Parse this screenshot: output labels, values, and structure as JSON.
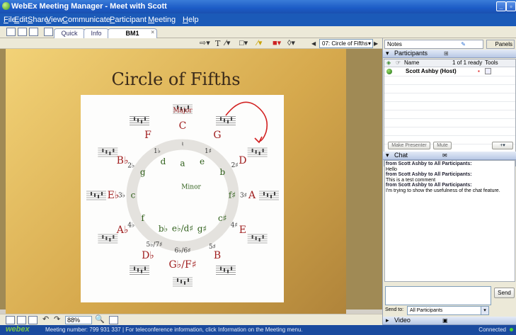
{
  "window": {
    "title": "WebEx Meeting Manager - Meet with Scott"
  },
  "menu": [
    "File",
    "Edit",
    "Share",
    "View",
    "Communicate",
    "Participant",
    "Meeting",
    "Help"
  ],
  "tabs": {
    "quick_start": "Quick Start",
    "info": "Info",
    "active": "BM1"
  },
  "annotation": {
    "slide_selector": "07: Circle of Fifths"
  },
  "slide": {
    "title": "Circle of Fifths",
    "major_label": "Major",
    "minor_label": "Minor",
    "outer_keys": [
      {
        "name": "C",
        "angle": 0,
        "r": 98
      },
      {
        "name": "G",
        "angle": 30,
        "r": 98
      },
      {
        "name": "D",
        "angle": 60,
        "r": 98
      },
      {
        "name": "A",
        "angle": 90,
        "r": 98
      },
      {
        "name": "E",
        "angle": 120,
        "r": 98
      },
      {
        "name": "B",
        "angle": 150,
        "r": 98
      },
      {
        "name": "G♭/F♯",
        "angle": 180,
        "r": 98
      },
      {
        "name": "D♭",
        "angle": 210,
        "r": 98
      },
      {
        "name": "A♭",
        "angle": 240,
        "r": 98
      },
      {
        "name": "E♭",
        "angle": 270,
        "r": 98
      },
      {
        "name": "B♭",
        "angle": 300,
        "r": 98
      },
      {
        "name": "F",
        "angle": 330,
        "r": 98
      }
    ],
    "minor_keys": [
      {
        "name": "a",
        "angle": 0,
        "r": 45
      },
      {
        "name": "e",
        "angle": 30,
        "r": 55
      },
      {
        "name": "b",
        "angle": 60,
        "r": 65
      },
      {
        "name": "f♯",
        "angle": 90,
        "r": 70
      },
      {
        "name": "c♯",
        "angle": 120,
        "r": 65
      },
      {
        "name": "g♯",
        "angle": 150,
        "r": 55
      },
      {
        "name": "e♭/d♯",
        "angle": 180,
        "r": 47
      },
      {
        "name": "b♭",
        "angle": 210,
        "r": 55
      },
      {
        "name": "f",
        "angle": 240,
        "r": 65
      },
      {
        "name": "c",
        "angle": 270,
        "r": 70
      },
      {
        "name": "g",
        "angle": 300,
        "r": 65
      },
      {
        "name": "d",
        "angle": 330,
        "r": 55
      }
    ],
    "accidentals": [
      {
        "name": "♮",
        "angle": 0,
        "r": 72
      },
      {
        "name": "1♯",
        "angle": 30,
        "r": 72
      },
      {
        "name": "2♯",
        "angle": 60,
        "r": 85
      },
      {
        "name": "3♯",
        "angle": 90,
        "r": 86
      },
      {
        "name": "4♯",
        "angle": 120,
        "r": 84
      },
      {
        "name": "5♯",
        "angle": 150,
        "r": 84
      },
      {
        "name": "6♭/6♯",
        "angle": 180,
        "r": 78
      },
      {
        "name": "5♭/7♯",
        "angle": 210,
        "r": 80
      },
      {
        "name": "4♭",
        "angle": 240,
        "r": 84
      },
      {
        "name": "3♭",
        "angle": 270,
        "r": 86
      },
      {
        "name": "2♭",
        "angle": 300,
        "r": 84
      },
      {
        "name": "1♭",
        "angle": 330,
        "r": 72
      }
    ],
    "staff_count": 12
  },
  "bottom": {
    "zoom": "88%"
  },
  "status": {
    "logo": "webex",
    "meeting_text": "Meeting number: 799 931 337 | For teleconference information, click Information on the Meeting menu.",
    "connection": "Connected"
  },
  "right": {
    "notes_label": "Notes",
    "panels_label": "Panels",
    "participants": {
      "header": "Participants",
      "col_name": "Name",
      "ready": "1 of 1 ready",
      "col_tools": "Tools",
      "rows": [
        {
          "name": "Scott Ashby (Host)"
        }
      ],
      "make_presenter": "Make Presenter",
      "mute": "Mute"
    },
    "chat": {
      "header": "Chat",
      "messages": [
        {
          "from": "from Scott Ashby to All Participants:",
          "text": "Hello"
        },
        {
          "from": "from Scott Ashby to All Participants:",
          "text": "This is a test comment"
        },
        {
          "from": "from Scott Ashby to All Participants:",
          "text": "I'm trying to show the usefulness of the chat feature."
        }
      ],
      "send": "Send",
      "send_to_label": "Send to:",
      "send_to_value": "All Participants"
    },
    "video_label": "Video"
  },
  "colors": {
    "major": "#a01f1f",
    "minor": "#2f5f1a",
    "accidental": "#333333",
    "annotation": "#d22222"
  }
}
